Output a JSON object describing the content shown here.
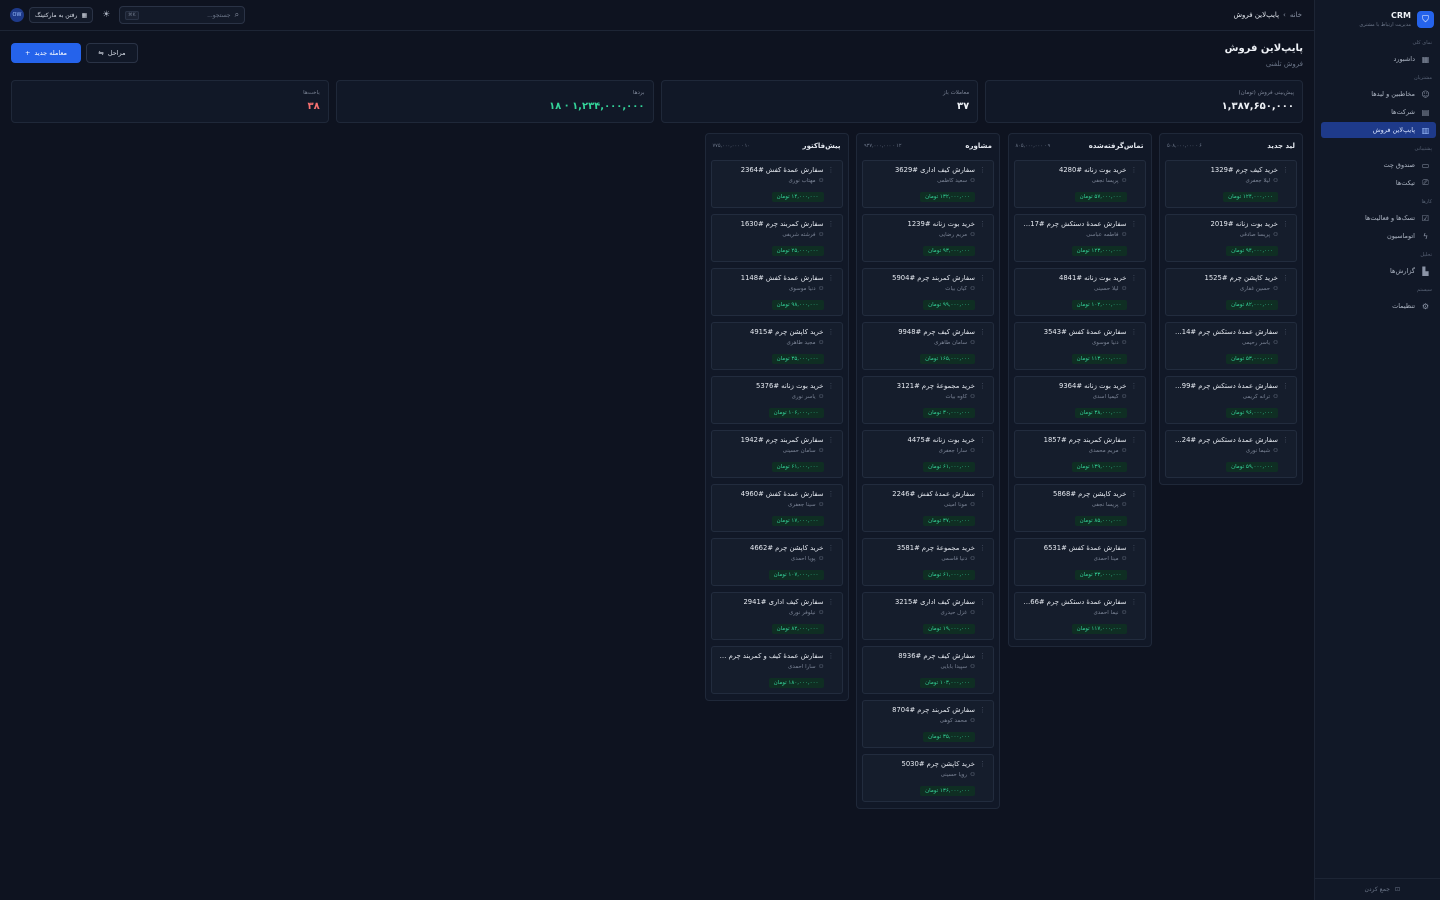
{
  "brand": {
    "name": "CRM",
    "subtitle": "مدیریت ارتباط با مشتری"
  },
  "sidebar": {
    "groups": [
      {
        "label": "نمای کلی",
        "items": [
          {
            "label": "داشبورد",
            "icon": "grid-icon"
          }
        ]
      },
      {
        "label": "مشتریان",
        "items": [
          {
            "label": "مخاطبین و لیدها",
            "icon": "users-icon"
          },
          {
            "label": "شرکت‌ها",
            "icon": "building-icon"
          },
          {
            "label": "پایپ‌لاین فروش",
            "icon": "kanban-icon",
            "active": true
          }
        ]
      },
      {
        "label": "پشتیبانی",
        "items": [
          {
            "label": "صندوق چت",
            "icon": "chat-icon"
          },
          {
            "label": "تیکت‌ها",
            "icon": "ticket-icon"
          }
        ]
      },
      {
        "label": "کارها",
        "items": [
          {
            "label": "تسک‌ها و فعالیت‌ها",
            "icon": "check-square-icon"
          },
          {
            "label": "اتوماسیون",
            "icon": "bolt-icon"
          }
        ]
      },
      {
        "label": "تحلیل",
        "items": [
          {
            "label": "گزارش‌ها",
            "icon": "bar-chart-icon"
          }
        ]
      },
      {
        "label": "سیستم",
        "items": [
          {
            "label": "تنظیمات",
            "icon": "gear-icon"
          }
        ]
      }
    ],
    "collapse_label": "جمع کردن"
  },
  "header": {
    "breadcrumb_home": "خانه",
    "breadcrumb_sep": "›",
    "breadcrumb_current": "پایپ‌لاین فروش",
    "search_placeholder": "جستجو...",
    "search_shortcut": "⌘K",
    "marketing_button": "رفتن به مارکتینگ",
    "avatar": "OW"
  },
  "page": {
    "title": "پایپ‌لاین فروش",
    "subtitle": "فروش تلفنی",
    "new_deal_button": "معامله جدید",
    "stages_button": "مراحل"
  },
  "stats": [
    {
      "label": "پیش‌بینی فروش (تومان)",
      "value": "۱,۳۸۷,۶۵۰,۰۰۰",
      "tone": "default"
    },
    {
      "label": "معاملات باز",
      "value": "۳۷",
      "tone": "default"
    },
    {
      "label": "بردها",
      "value": "۱,۲۳۴,۰۰۰,۰۰۰ · ۱۸",
      "tone": "green"
    },
    {
      "label": "باخت‌ها",
      "value": "۳۸",
      "tone": "red"
    }
  ],
  "columns": [
    {
      "name": "لید جدید",
      "meta": "۶ · ۵۰۸,۰۰۰,۰۰۰",
      "cards": [
        {
          "title": "خرید کیف چرم #1329",
          "contact": "لیلا جعفری",
          "amount": "۱۲۴,۰۰۰,۰۰۰ تومان"
        },
        {
          "title": "خرید بوت زنانه #2019",
          "contact": "پریسا صادقی",
          "amount": "۹۴,۰۰۰,۰۰۰ تومان"
        },
        {
          "title": "خرید کاپشن چرم #1525",
          "contact": "حسین غفاری",
          "amount": "۸۲,۰۰۰,۰۰۰ تومان"
        },
        {
          "title": "سفارش عمدهٔ دستکش چرم #14…",
          "contact": "یاسر رحیمی",
          "amount": "۵۳,۰۰۰,۰۰۰ تومان"
        },
        {
          "title": "سفارش عمدهٔ دستکش چرم #99…",
          "contact": "ترانه کریمی",
          "amount": "۹۶,۰۰۰,۰۰۰ تومان"
        },
        {
          "title": "سفارش عمدهٔ دستکش چرم #24…",
          "contact": "شیما نوری",
          "amount": "۵۹,۰۰۰,۰۰۰ تومان"
        }
      ]
    },
    {
      "name": "تماس‌گرفته‌شده",
      "meta": "۹ · ۸۰۵,۰۰۰,۰۰۰",
      "cards": [
        {
          "title": "خرید بوت زنانه #4280",
          "contact": "پریسا نجفی",
          "amount": "۵۷,۰۰۰,۰۰۰ تومان"
        },
        {
          "title": "سفارش عمدهٔ دستکش چرم #17…",
          "contact": "فاطمه عباسی",
          "amount": "۱۲۳,۰۰۰,۰۰۰ تومان"
        },
        {
          "title": "خرید بوت زنانه #4841",
          "contact": "لیلا حسینی",
          "amount": "۱۰۲,۰۰۰,۰۰۰ تومان"
        },
        {
          "title": "سفارش عمدهٔ کفش #3543",
          "contact": "دنیا موسوی",
          "amount": "۱۱۳,۰۰۰,۰۰۰ تومان"
        },
        {
          "title": "خرید بوت زنانه #9364",
          "contact": "کیمیا اسدی",
          "amount": "۳۸,۰۰۰,۰۰۰ تومان"
        },
        {
          "title": "سفارش کمربند چرم #1857",
          "contact": "مریم محمدی",
          "amount": "۱۳۹,۰۰۰,۰۰۰ تومان"
        },
        {
          "title": "خرید کاپشن چرم #5868",
          "contact": "پریسا نجفی",
          "amount": "۸۵,۰۰۰,۰۰۰ تومان"
        },
        {
          "title": "سفارش عمدهٔ کفش #6531",
          "contact": "مینا احمدی",
          "amount": "۳۳,۰۰۰,۰۰۰ تومان"
        },
        {
          "title": "سفارش عمدهٔ دستکش چرم #66…",
          "contact": "نیما احمدی",
          "amount": "۱۱۷,۰۰۰,۰۰۰ تومان"
        }
      ]
    },
    {
      "name": "مشاوره",
      "meta": "۱۲ · ۹۳۷,۰۰۰,۰۰۰",
      "cards": [
        {
          "title": "سفارش کیف اداری #3629",
          "contact": "سعید کاظمی",
          "amount": "۱۳۲,۰۰۰,۰۰۰ تومان"
        },
        {
          "title": "خرید بوت زنانه #1239",
          "contact": "مریم رضایی",
          "amount": "۹۳,۰۰۰,۰۰۰ تومان"
        },
        {
          "title": "سفارش کمربند چرم #5904",
          "contact": "کیان بیات",
          "amount": "۹۹,۰۰۰,۰۰۰ تومان"
        },
        {
          "title": "سفارش کیف چرم #9948",
          "contact": "سامان طاهری",
          "amount": "۱۶۵,۰۰۰,۰۰۰ تومان"
        },
        {
          "title": "خرید مجموعهٔ چرم #3121",
          "contact": "کاوه بیات",
          "amount": "۳۰,۰۰۰,۰۰۰ تومان"
        },
        {
          "title": "خرید بوت زنانه #4475",
          "contact": "سارا جعفری",
          "amount": "۶۱,۰۰۰,۰۰۰ تومان"
        },
        {
          "title": "سفارش عمدهٔ کفش #2246",
          "contact": "مونا امینی",
          "amount": "۳۷,۰۰۰,۰۰۰ تومان"
        },
        {
          "title": "خرید مجموعهٔ چرم #3581",
          "contact": "دنیا قاسمی",
          "amount": "۶۱,۰۰۰,۰۰۰ تومان"
        },
        {
          "title": "سفارش کیف اداری #3215",
          "contact": "غزل حیدری",
          "amount": "۱۹,۰۰۰,۰۰۰ تومان"
        },
        {
          "title": "سفارش کیف چرم #8936",
          "contact": "سپیدا بابایی",
          "amount": "۱۰۳,۰۰۰,۰۰۰ تومان"
        },
        {
          "title": "سفارش کمربند چرم #8704",
          "contact": "محمد کوهی",
          "amount": "۳۵,۰۰۰,۰۰۰ تومان"
        },
        {
          "title": "خرید کاپشن چرم #5030",
          "contact": "رویا حسینی",
          "amount": "۱۳۶,۰۰۰,۰۰۰ تومان"
        }
      ]
    },
    {
      "name": "پیش‌فاکتور",
      "meta": "۱۰ · ۷۷۵,۰۰۰,۰۰۰",
      "cards": [
        {
          "title": "سفارش عمدهٔ کفش #2364",
          "contact": "مهتاب نوری",
          "amount": "۱۴,۰۰۰,۰۰۰ تومان"
        },
        {
          "title": "سفارش کمربند چرم #1630",
          "contact": "فرشته شریفی",
          "amount": "۲۵,۰۰۰,۰۰۰ تومان"
        },
        {
          "title": "سفارش عمدهٔ کفش #1148",
          "contact": "دنیا موسوی",
          "amount": "۹۸,۰۰۰,۰۰۰ تومان"
        },
        {
          "title": "خرید کاپشن چرم #4915",
          "contact": "مجید طاهری",
          "amount": "۳۵,۰۰۰,۰۰۰ تومان"
        },
        {
          "title": "خرید بوت زنانه #5376",
          "contact": "یاسر نوری",
          "amount": "۱۰۶,۰۰۰,۰۰۰ تومان"
        },
        {
          "title": "سفارش کمربند چرم #1942",
          "contact": "سامان حسینی",
          "amount": "۶۱,۰۰۰,۰۰۰ تومان"
        },
        {
          "title": "سفارش عمدهٔ کفش #4960",
          "contact": "سینا جعفری",
          "amount": "۱۷,۰۰۰,۰۰۰ تومان"
        },
        {
          "title": "خرید کاپشن چرم #4662",
          "contact": "پویا احمدی",
          "amount": "۱۰۷,۰۰۰,۰۰۰ تومان"
        },
        {
          "title": "سفارش کیف اداری #2941",
          "contact": "نیلوفر نوری",
          "amount": "۸۲,۰۰۰,۰۰۰ تومان"
        },
        {
          "title": "سفارش عمدهٔ کیف و کمربند چرم …",
          "contact": "سارا احمدی",
          "amount": "۱۸۰,۰۰۰,۰۰۰ تومان"
        }
      ]
    }
  ],
  "colors": {
    "accent": "#2563eb",
    "active_nav": "#1e3a8a",
    "win": "#34d399",
    "loss": "#f87171",
    "bg": "#0e1320"
  }
}
